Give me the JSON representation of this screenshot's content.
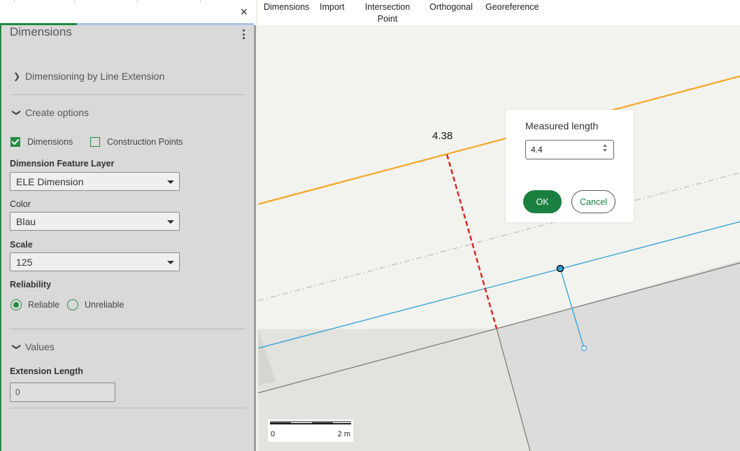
{
  "panel": {
    "title": "Dimensions",
    "close_glyph": "×",
    "sections": {
      "line_extension": "Dimensioning by Line Extension",
      "create_options": "Create options",
      "values": "Values"
    },
    "checkboxes": [
      {
        "label": "Dimensions",
        "checked": true
      },
      {
        "label": "Construction Points",
        "checked": false
      }
    ],
    "fields": {
      "feature_layer_label": "Dimension Feature Layer",
      "feature_layer_value": "ELE Dimension",
      "color_label": "Color",
      "color_value": "Blau",
      "scale_label": "Scale",
      "scale_value": "125",
      "reliability_label": "Reliability",
      "extension_length_label": "Extension Length",
      "extension_length_value": "0"
    },
    "reliability_options": [
      {
        "label": "Reliable",
        "selected": true
      },
      {
        "label": "Unreliable",
        "selected": false
      }
    ]
  },
  "toolbar": {
    "items": [
      "Dimensions",
      "Import",
      "Intersection Point",
      "Orthogonal",
      "Georeference"
    ]
  },
  "map": {
    "measurement_label": "4.38",
    "dialog": {
      "title": "Measured length",
      "input_value": "4.4",
      "ok_label": "OK",
      "cancel_label": "Cancel"
    },
    "scale_bar": {
      "start": "0",
      "end": "2 m"
    }
  },
  "colors": {
    "accent_green": "#1a8040",
    "orange_line": "#f5a623",
    "blue_line": "#2a9fd6",
    "red_dim": "#e02020"
  }
}
